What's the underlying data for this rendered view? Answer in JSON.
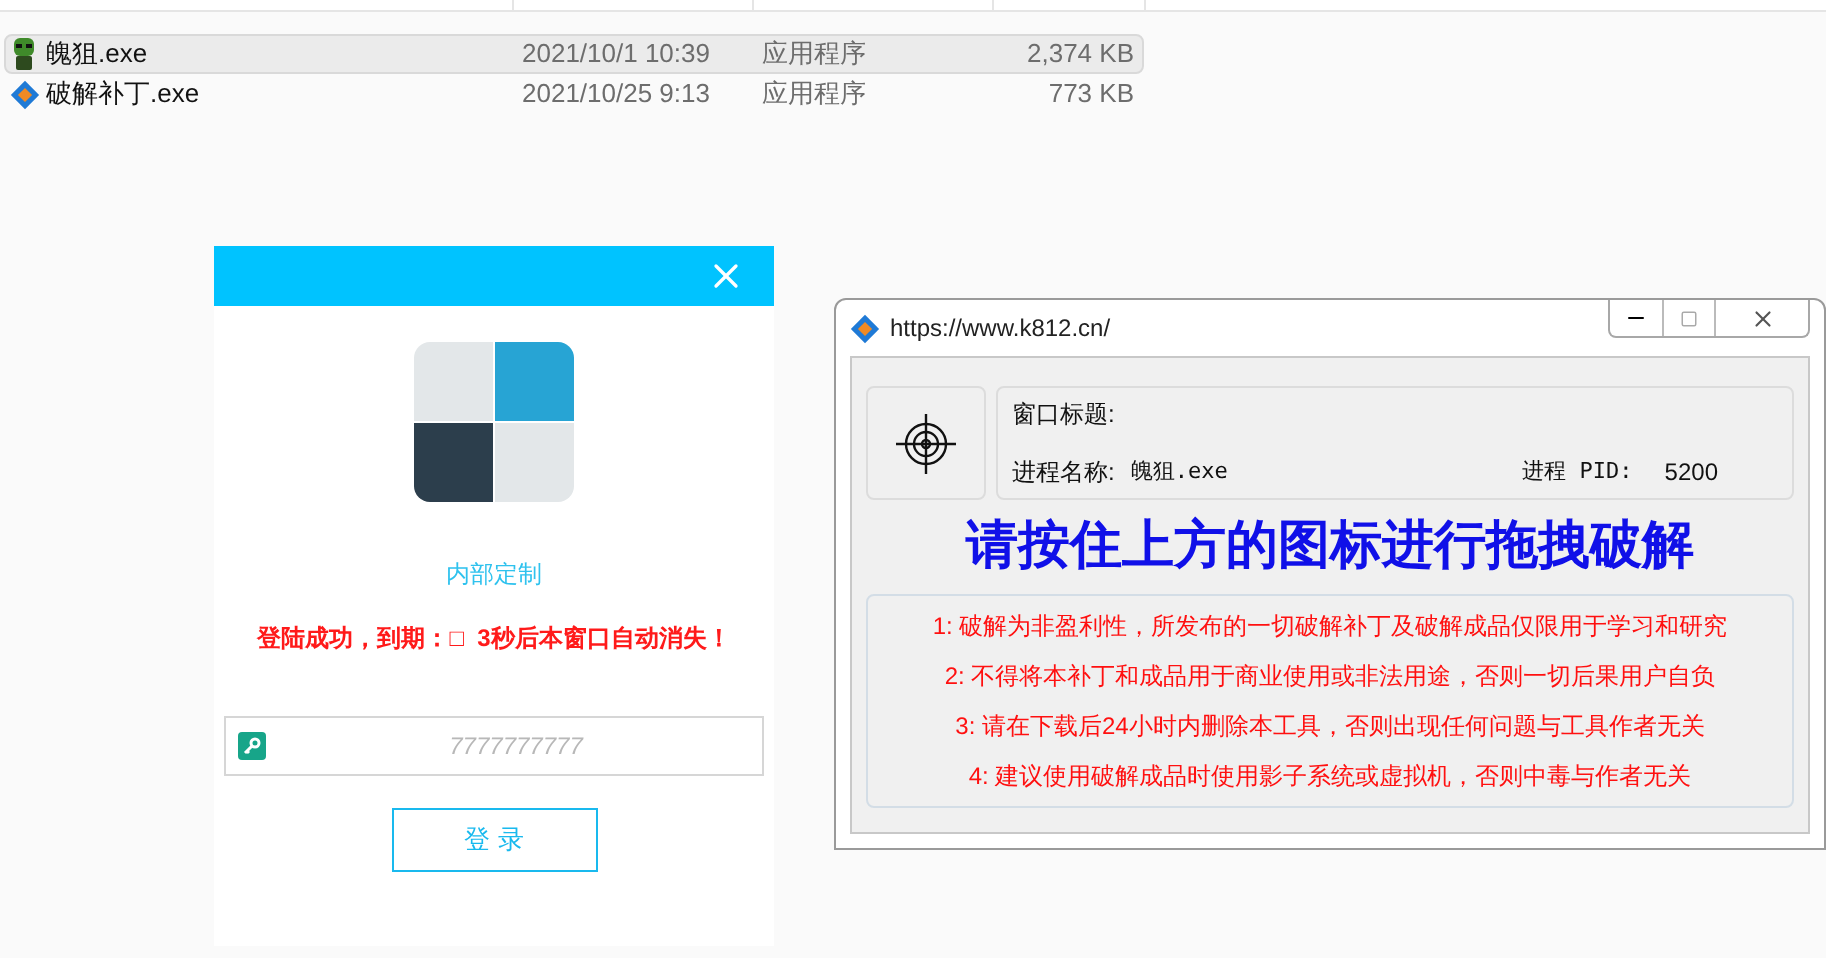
{
  "file_list": {
    "rows": [
      {
        "kind": "game",
        "name": "魄狙.exe",
        "date": "2021/10/1 10:39",
        "type": "应用程序",
        "size": "2,374 KB",
        "selected": true
      },
      {
        "kind": "patch",
        "name": "破解补丁.exe",
        "date": "2021/10/25 9:13",
        "type": "应用程序",
        "size": "773 KB",
        "selected": false
      }
    ]
  },
  "login_window": {
    "subtitle": "内部定制",
    "status": "登陆成功，到期：□  3秒后本窗口自动消失！",
    "key_field": {
      "placeholder": "7777777777"
    },
    "login_button": "登 录"
  },
  "patch_window": {
    "title": "https://www.k812.cn/",
    "window_title_label": "窗口标题:",
    "process_name_label": "进程名称:",
    "process_name": "魄狙.exe",
    "pid_label": "进程 PID:",
    "pid": "5200",
    "banner": "请按住上方的图标进行拖拽破解",
    "notices": [
      "1: 破解为非盈利性，所发布的一切破解补丁及破解成品仅限用于学习和研究",
      "2: 不得将本补丁和成品用于商业使用或非法用途，否则一切后果用户自负",
      "3: 请在下载后24小时内删除本工具，否则出现任何问题与工具作者无关",
      "4: 建议使用破解成品时使用影子系统或虚拟机，否则中毒与作者无关"
    ]
  }
}
